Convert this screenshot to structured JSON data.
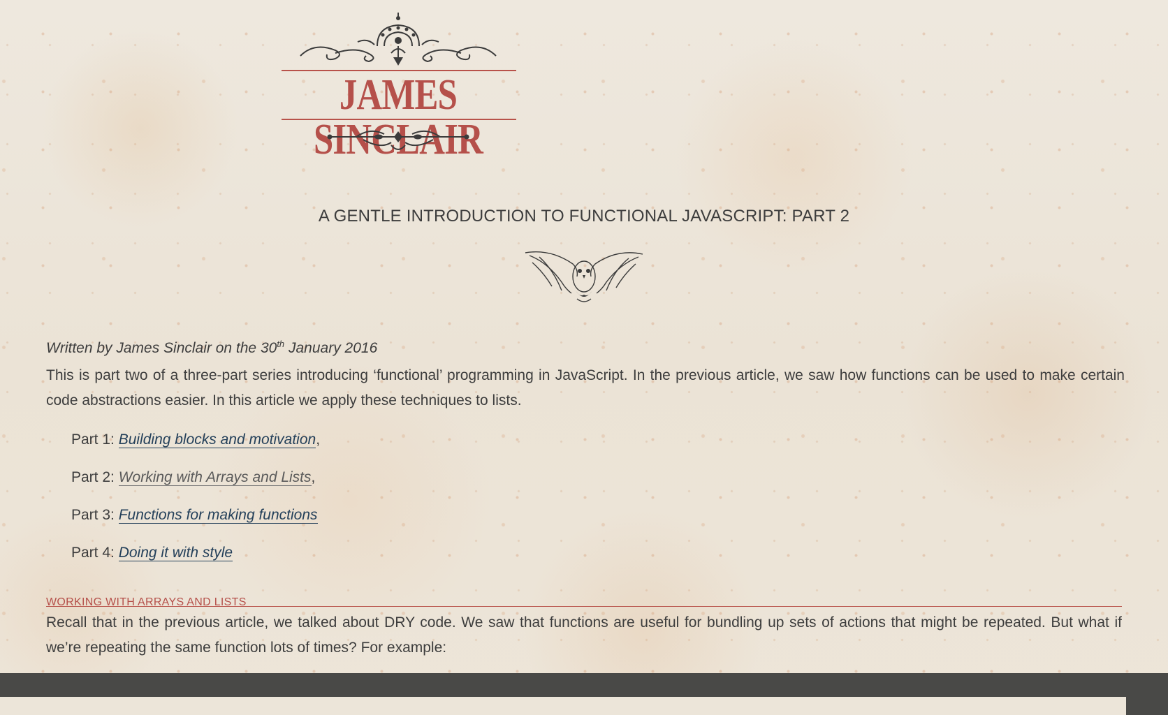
{
  "site": {
    "logo_text": "JAMES SINCLAIR"
  },
  "post": {
    "title": "A GENTLE INTRODUCTION TO FUNCTIONAL JAVASCRIPT: PART 2",
    "byline": {
      "prefix": "Written by James Sinclair on the 30",
      "ordinal": "th",
      "suffix": " January 2016"
    },
    "intro": "This is part two of a three-part series introducing ‘functional’ programming in JavaScript. In the previous article, we saw how functions can be used to make certain code abstractions easier. In this article we apply these techniques to lists.",
    "series": [
      {
        "prefix": "Part 1: ",
        "link": "Building blocks and motivation",
        "suffix": ","
      },
      {
        "prefix": "Part 2: ",
        "link": "Working with Arrays and Lists",
        "suffix": ","
      },
      {
        "prefix": "Part 3: ",
        "link": "Functions for making functions",
        "suffix": ""
      },
      {
        "prefix": "Part 4: ",
        "link": "Doing it with style",
        "suffix": ""
      }
    ],
    "section_heading": "WORKING WITH ARRAYS AND LISTS",
    "paragraph2": "Recall that in the previous article, we talked about DRY code. We saw that functions are useful for bundling up sets of actions that might be repeated. But what if we’re repeating the same function lots of times? For example:"
  },
  "colors": {
    "accent": "#b5504a",
    "text": "#3d3d3d",
    "link": "#24405a",
    "code_bar": "#494947",
    "paper": "#ede6da"
  },
  "icons": {
    "logo_ornament_top": "flourish-ornament",
    "logo_ornament_bottom": "scroll-ornament",
    "title_ornament": "owl-icon"
  }
}
